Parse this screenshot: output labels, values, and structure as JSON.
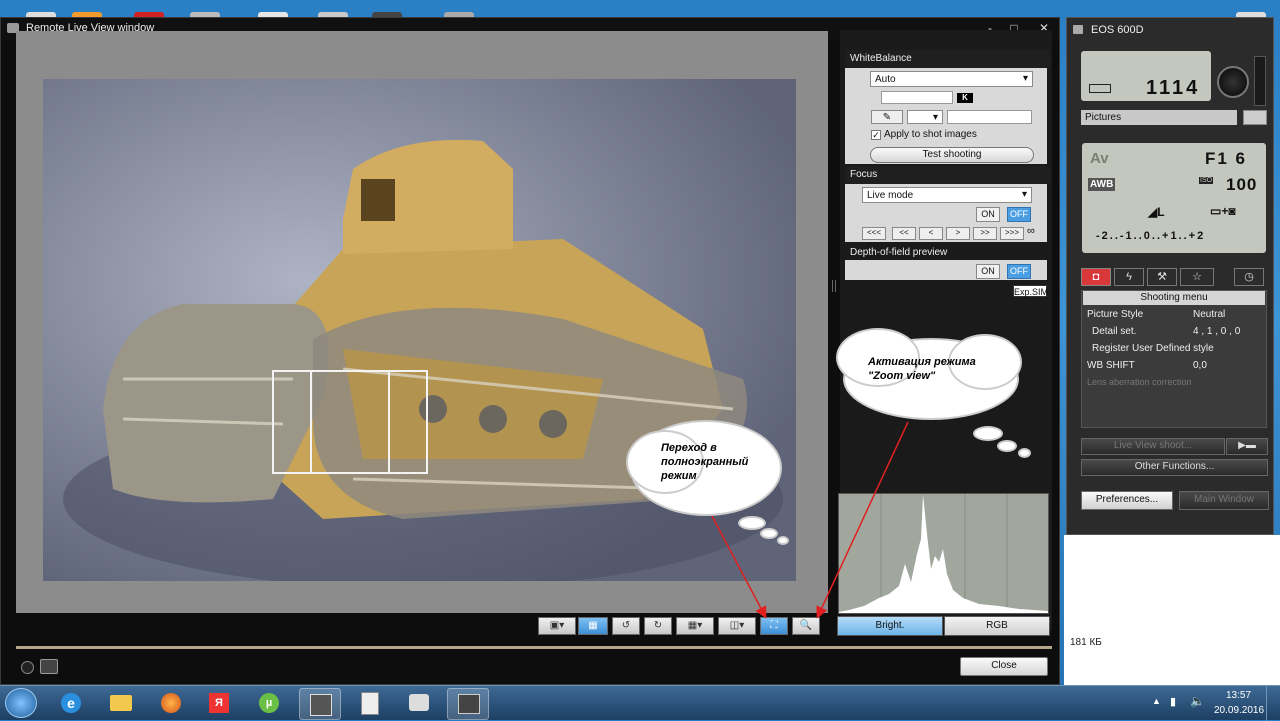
{
  "main_window": {
    "title": "Remote Live View window",
    "close_label": "Close",
    "controls": {
      "minimize": "-",
      "maximize": "□",
      "close": "✕"
    }
  },
  "white_balance": {
    "title": "WhiteBalance",
    "mode": "Auto",
    "kelvin_label": "K",
    "apply_label": "Apply to shot images",
    "test_label": "Test shooting"
  },
  "focus": {
    "title": "Focus",
    "mode": "Live mode",
    "on": "ON",
    "off": "OFF",
    "nav": [
      "<<<",
      "<<",
      "<",
      ">",
      ">>",
      ">>>",
      "∞"
    ]
  },
  "dof": {
    "title": "Depth-of-field preview",
    "on": "ON",
    "off": "OFF",
    "expsim": "Exp.SIM"
  },
  "histogram_tabs": [
    "Bright.",
    "RGB"
  ],
  "callouts": {
    "zoom": "Активация режима \"Zoom view\"",
    "fullscreen": "Переход в полноэкранный режим"
  },
  "camera": {
    "title": "EOS 600D",
    "shots": "1114",
    "folder": "Pictures",
    "mode": "Av",
    "aperture": "F1 6",
    "wb": "AWB",
    "iso": "100",
    "iso_label": "ISO",
    "quality": "◢L",
    "exposure_scale": "-2..-1..0..+1..+2",
    "menu_title": "Shooting menu",
    "menu": [
      {
        "label": "Picture Style",
        "value": "Neutral"
      },
      {
        "label": "Detail set.",
        "value": "4 , 1 , 0 , 0"
      },
      {
        "label": "Register User Defined style",
        "value": ""
      },
      {
        "label": "WB SHIFT",
        "value": "0,0"
      },
      {
        "label": "Lens aberration correction",
        "value": ""
      }
    ],
    "live_view_btn": "Live View shoot...",
    "other_functions": "Other Functions...",
    "preferences": "Preferences...",
    "main_window": "Main Window"
  },
  "explorer": {
    "size": "181 КБ"
  },
  "tray": {
    "time": "13:57",
    "date": "20.09.2016"
  },
  "colors": {
    "accent": "#4c9ee2",
    "arrow": "#e02020"
  }
}
